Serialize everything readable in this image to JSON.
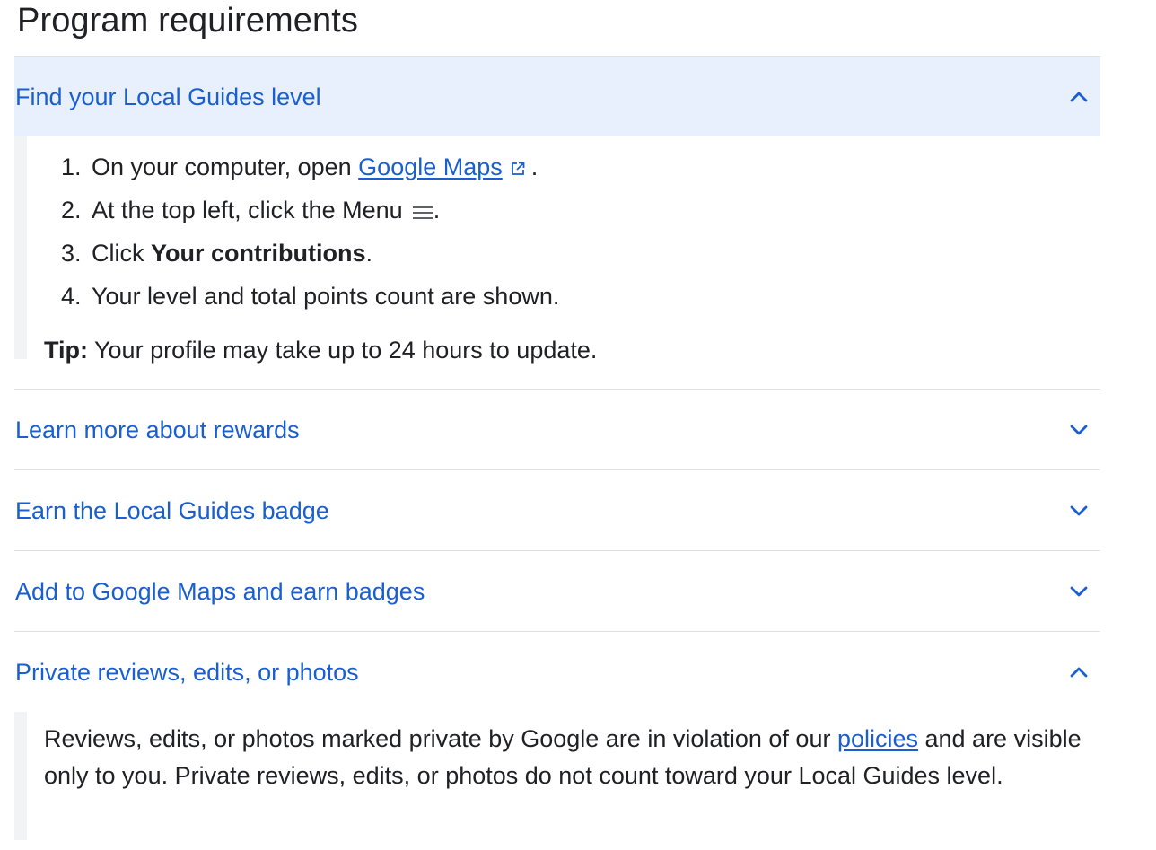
{
  "title": "Program requirements",
  "sections": [
    {
      "title": "Find your Local Guides level",
      "state": "expanded",
      "chevron": "chevron-up-icon",
      "steps": [
        {
          "num": "1.",
          "text_before": "On your computer, open ",
          "link_text": "Google Maps",
          "link_icon": "external-link-icon",
          "text_after": "."
        },
        {
          "num": "2.",
          "text_before": "At the top left, click the Menu",
          "icon": "menu-icon",
          "text_after": "."
        },
        {
          "num": "3.",
          "text_before": "Click ",
          "bold": "Your contributions",
          "text_after": "."
        },
        {
          "num": "4.",
          "text": "Your level and total points count are shown."
        }
      ],
      "tip_label": "Tip:",
      "tip_text": " Your profile may take up to 24 hours to update."
    },
    {
      "title": "Learn more about rewards",
      "state": "collapsed",
      "chevron": "chevron-down-icon"
    },
    {
      "title": "Earn the Local Guides badge",
      "state": "collapsed",
      "chevron": "chevron-down-icon"
    },
    {
      "title": "Add to Google Maps and earn badges",
      "state": "collapsed",
      "chevron": "chevron-down-icon"
    },
    {
      "title": "Private reviews, edits, or photos",
      "state": "expanded",
      "chevron": "chevron-up-icon",
      "body_before": "Reviews, edits, or photos marked private by Google are in violation of our ",
      "body_link": "policies",
      "body_after": " and are visible only to you. Private reviews, edits, or photos do not count toward your Local Guides level."
    }
  ],
  "colors": {
    "link": "#1a5fd0",
    "text": "#202124",
    "open_header_bg": "#e8f0fe",
    "body_rule": "#f1f3f4",
    "divider": "#e0e0e0"
  }
}
